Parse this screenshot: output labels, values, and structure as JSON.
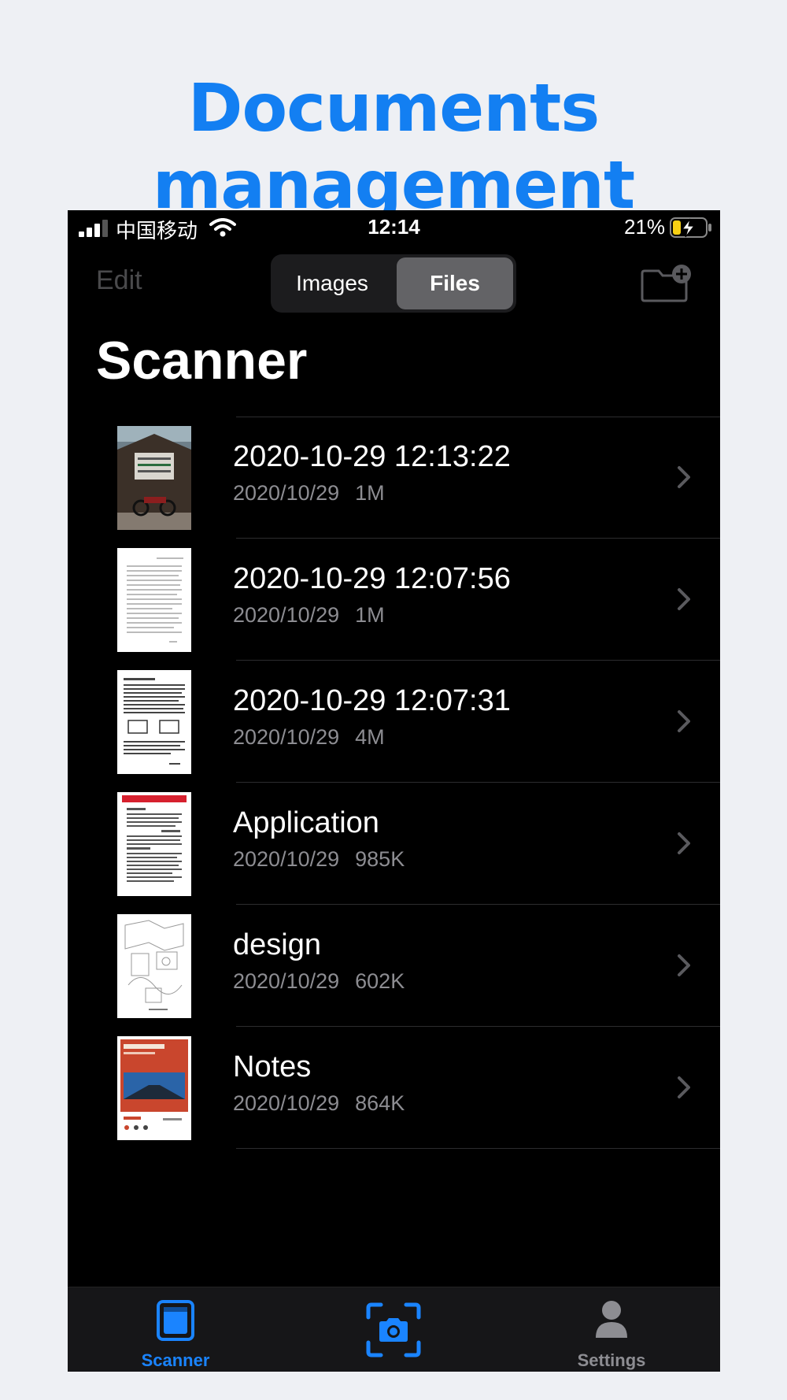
{
  "headline": "Documents  management",
  "status": {
    "carrier": "中国移动",
    "time": "12:14",
    "battery": "21%"
  },
  "nav": {
    "edit": "Edit",
    "segments": [
      "Images",
      "Files"
    ],
    "selected_segment": "Files",
    "title": "Scanner"
  },
  "files": [
    {
      "title": "2020-10-29 12:13:22",
      "date": "2020/10/29",
      "size": "1M",
      "thumb": "photo-building"
    },
    {
      "title": "2020-10-29 12:07:56",
      "date": "2020/10/29",
      "size": "1M",
      "thumb": "text-page"
    },
    {
      "title": "2020-10-29 12:07:31",
      "date": "2020/10/29",
      "size": "4M",
      "thumb": "text-diagram-page"
    },
    {
      "title": "Application",
      "date": "2020/10/29",
      "size": "985K",
      "thumb": "red-header-page"
    },
    {
      "title": "design",
      "date": "2020/10/29",
      "size": "602K",
      "thumb": "sketch-page"
    },
    {
      "title": "Notes",
      "date": "2020/10/29",
      "size": "864K",
      "thumb": "book-cover"
    }
  ],
  "tabs": {
    "scanner": "Scanner",
    "settings": "Settings"
  },
  "colors": {
    "accent": "#1a84ff",
    "headline": "#137ff2",
    "background": "#eef0f4"
  }
}
